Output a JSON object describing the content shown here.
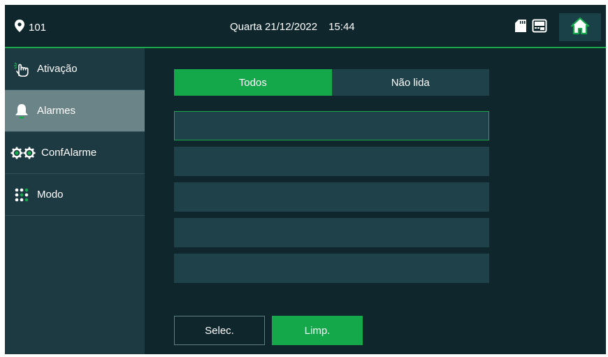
{
  "header": {
    "room_number": "101",
    "weekday": "Quarta",
    "date": "21/12/2022",
    "time": "15:44"
  },
  "sidebar": {
    "items": [
      {
        "label": "Ativação",
        "icon": "hand-touch-icon"
      },
      {
        "label": "Alarmes",
        "icon": "bell-icon",
        "active": true
      },
      {
        "label": "ConfAlarme",
        "icon": "gears-icon"
      },
      {
        "label": "Modo",
        "icon": "dots-grid-icon"
      }
    ]
  },
  "main": {
    "tabs": [
      {
        "label": "Todos",
        "active": true
      },
      {
        "label": "Não lida",
        "active": false
      }
    ],
    "list_rows": 5,
    "select_label": "Selec.",
    "clear_label": "Limp."
  },
  "colors": {
    "background": "#0f262c",
    "accent_green": "#14a84b",
    "panel": "#1f414a",
    "sidebar": "#1d3a42",
    "sidebar_active": "#6b8488"
  }
}
